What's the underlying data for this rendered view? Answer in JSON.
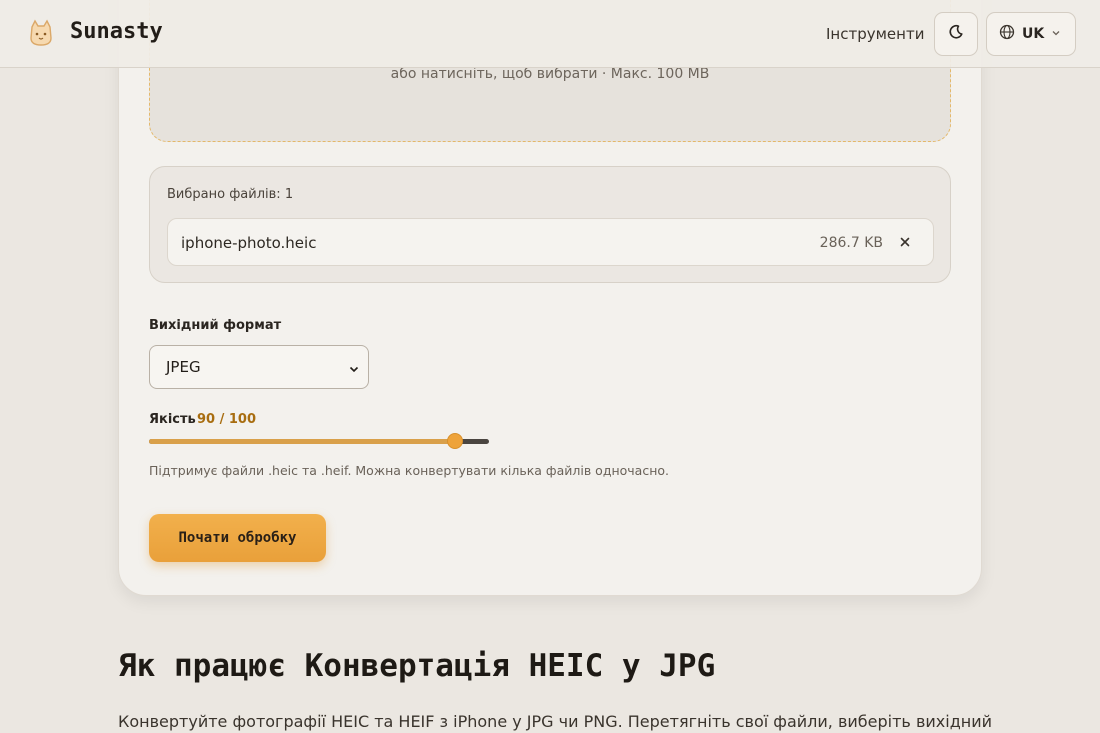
{
  "header": {
    "brand": "Sunasty",
    "nav_tools": "Інструменти",
    "language": "UK"
  },
  "dropzone": {
    "hint": "або натисніть, щоб вибрати · Макс. 100 MB"
  },
  "files": {
    "count_label": "Вибрано файлів: 1",
    "items": [
      {
        "name": "iphone-photo.heic",
        "size": "286.7 KB"
      }
    ]
  },
  "format": {
    "label": "Вихідний формат",
    "selected": "JPEG"
  },
  "quality": {
    "label": "Якість",
    "value_text": "90 / 100",
    "value": 90,
    "max": 100
  },
  "helper_text": "Підтримує файли .heic та .heif. Можна конвертувати кілька файлів одночасно.",
  "start_button": "Почати обробку",
  "how_it_works": {
    "title": "Як працює Конвертація HEIC у JPG",
    "text": "Конвертуйте фотографії HEIC та HEIF з iPhone у JPG чи PNG. Перетягніть свої файли, виберіть вихідний"
  },
  "colors": {
    "accent": "#eea33a",
    "accent_text": "#a86d10",
    "background": "#ebe7e1"
  }
}
